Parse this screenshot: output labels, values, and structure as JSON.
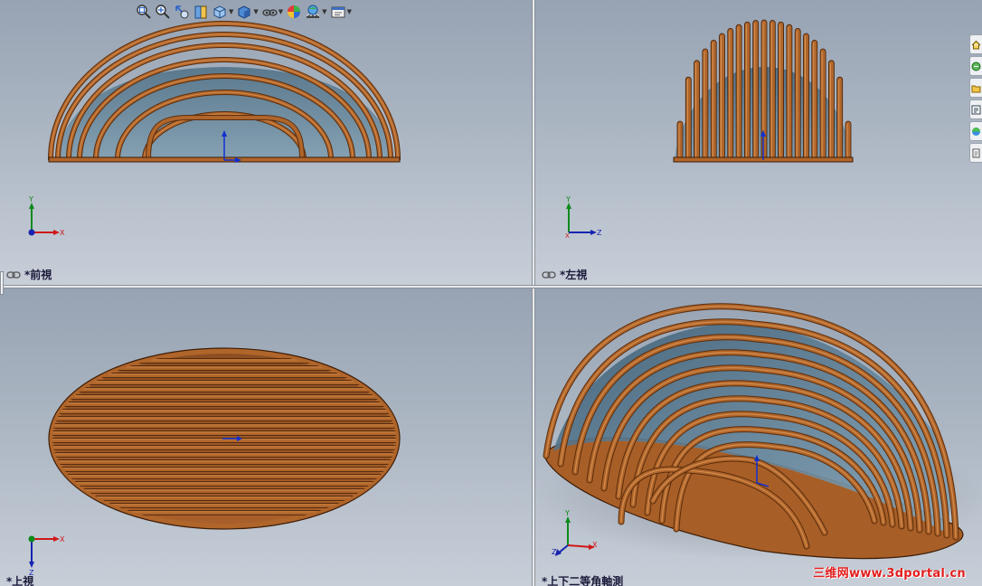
{
  "viewports": {
    "front": {
      "label": "*前視"
    },
    "left": {
      "label": "*左視"
    },
    "top": {
      "label": "*上視"
    },
    "isometric": {
      "label": "*上下二等角軸測"
    }
  },
  "triads": {
    "front": {
      "vertical": "Y",
      "horizontal": "X"
    },
    "left": {
      "vertical": "Y",
      "horizontal": "Z",
      "origin": "X"
    },
    "top": {
      "vertical": "Z",
      "horizontal": "X"
    },
    "isometric": {
      "vertical": "Y",
      "horizontal": "X",
      "depth": "Z"
    }
  },
  "hud_toolbar": {
    "buttons": [
      {
        "name": "zoom-to-fit",
        "icon": "zoom-fit-icon",
        "dropdown": false
      },
      {
        "name": "zoom-to-area",
        "icon": "zoom-area-icon",
        "dropdown": false
      },
      {
        "name": "previous-view",
        "icon": "previous-view-icon",
        "dropdown": false
      },
      {
        "name": "section-view",
        "icon": "section-view-icon",
        "dropdown": false
      },
      {
        "name": "view-orientation",
        "icon": "view-orientation-icon",
        "dropdown": true
      },
      {
        "name": "display-style",
        "icon": "display-style-icon",
        "dropdown": true
      },
      {
        "name": "hide-show-items",
        "icon": "hide-show-icon",
        "dropdown": true
      },
      {
        "name": "edit-appearance",
        "icon": "appearance-icon",
        "dropdown": false
      },
      {
        "name": "apply-scene",
        "icon": "scene-icon",
        "dropdown": true
      },
      {
        "name": "view-settings",
        "icon": "view-settings-icon",
        "dropdown": true
      }
    ]
  },
  "task_pane": {
    "tabs": [
      "home-icon",
      "design-library-icon",
      "file-explorer-icon",
      "view-palette-icon",
      "appearances-icon",
      "custom-properties-icon"
    ]
  },
  "watermark": "三维网www.3dportal.cn",
  "colors": {
    "rib": "#b0652a",
    "rib_dark": "#5a2d0c",
    "rib_light": "#d99456",
    "glass": "#5e7f94",
    "background_top": "#97a3b3",
    "background_bottom": "#c7ced8"
  }
}
